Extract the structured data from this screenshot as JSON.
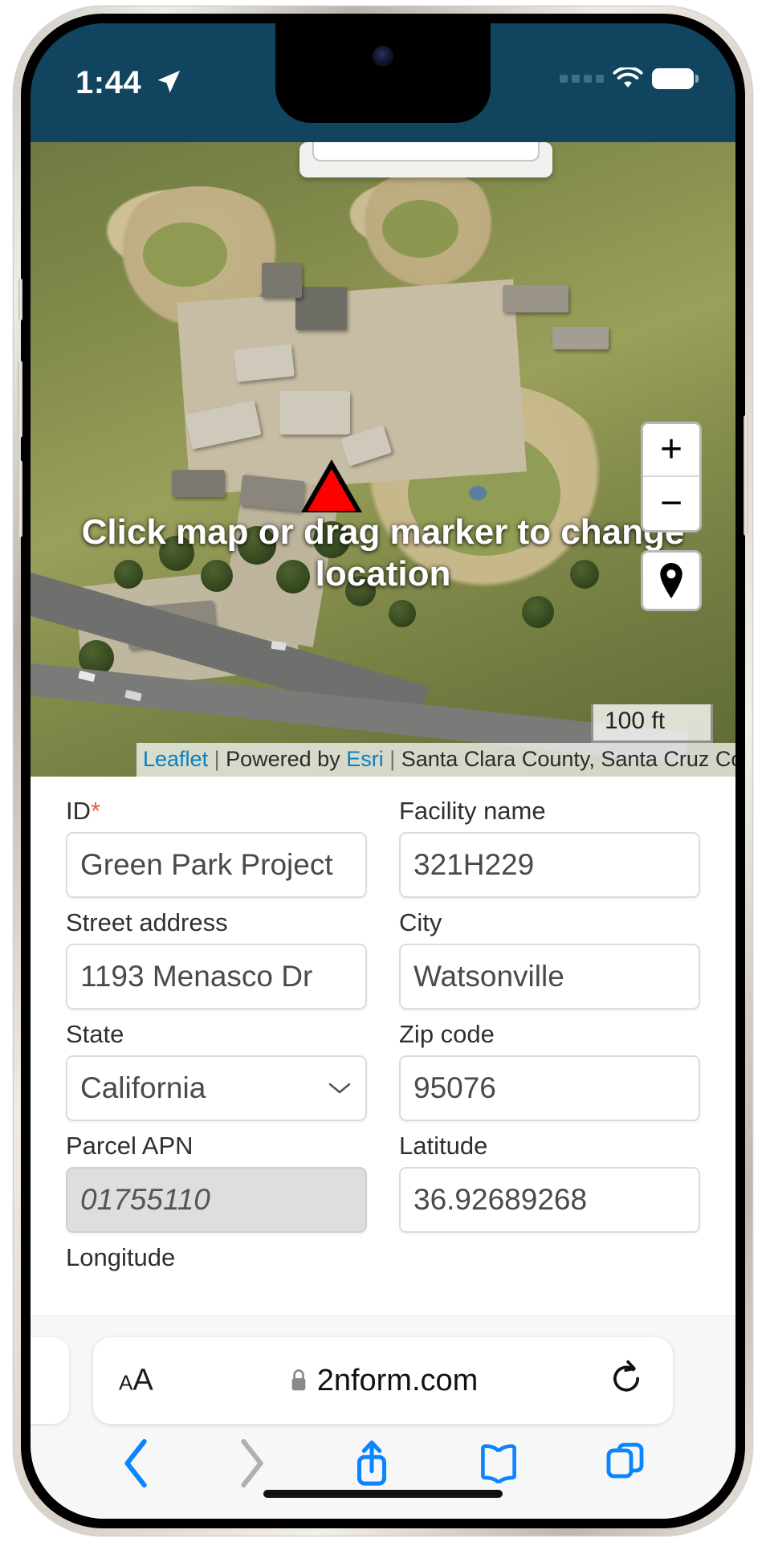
{
  "status_bar": {
    "time": "1:44",
    "location_icon": "location-arrow-icon",
    "signal_icon": "cellular-signal-icon",
    "wifi_icon": "wifi-icon",
    "battery_icon": "battery-icon",
    "background_color": "#10445f"
  },
  "map": {
    "overlay_text": "Click map or drag marker to change location",
    "marker_icon": "red-triangle-marker",
    "marker_color": "#ff0000",
    "zoom_in_label": "+",
    "zoom_out_label": "−",
    "locate_icon": "map-pin-icon",
    "scale_label": "100 ft",
    "attribution": {
      "leaflet": "Leaflet",
      "sep1": " | ",
      "powered_by": "Powered by ",
      "esri": "Esri",
      "sep2": " | ",
      "sources": "Santa Clara County, Santa Cruz County,..."
    }
  },
  "form": {
    "rows": [
      {
        "left": {
          "label": "ID",
          "required": true,
          "value": "Green Park Project",
          "type": "text"
        },
        "right": {
          "label": "Facility name",
          "required": false,
          "value": "321H229",
          "type": "text"
        }
      },
      {
        "left": {
          "label": "Street address",
          "required": false,
          "value": "1193 Menasco Dr",
          "type": "text"
        },
        "right": {
          "label": "City",
          "required": false,
          "value": "Watsonville",
          "type": "text"
        }
      },
      {
        "left": {
          "label": "State",
          "required": false,
          "value": "California",
          "type": "select"
        },
        "right": {
          "label": "Zip code",
          "required": false,
          "value": "95076",
          "type": "text"
        }
      },
      {
        "left": {
          "label": "Parcel APN",
          "required": false,
          "value": "01755110",
          "type": "disabled"
        },
        "right": {
          "label": "Latitude",
          "required": false,
          "value": "36.92689268",
          "type": "text"
        }
      }
    ],
    "partial_label": "Longitude",
    "required_marker": "*",
    "required_color": "#e8584c"
  },
  "safari": {
    "text_size_small": "A",
    "text_size_large": "A",
    "lock_icon": "lock-icon",
    "url": "2nform.com",
    "reload_icon": "reload-icon",
    "back_icon": "chevron-left-icon",
    "forward_icon": "chevron-right-icon",
    "share_icon": "share-icon",
    "bookmarks_icon": "book-icon",
    "tabs_icon": "tabs-icon",
    "accent_color": "#0a84ff",
    "disabled_color": "#b0b0b0"
  }
}
